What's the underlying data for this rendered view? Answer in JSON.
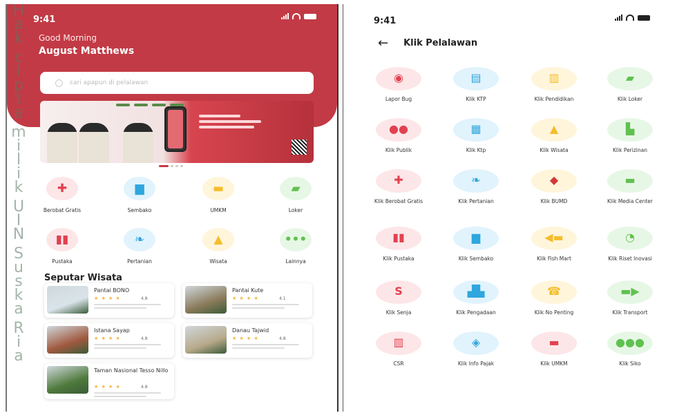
{
  "left_screen": {
    "status_time": "9:41",
    "greeting": "Good Morning",
    "user_name": "August Matthews",
    "search_placeholder": "cari apapun di pelalawan",
    "menu": [
      {
        "label": "Berobat Gratis",
        "icon": "medkit-icon",
        "glyph": "✚",
        "bg": "#fde6e8",
        "fg": "#e2414f"
      },
      {
        "label": "Sembako",
        "icon": "basket-icon",
        "glyph": "▆",
        "bg": "#e1f3fc",
        "fg": "#2ea6de"
      },
      {
        "label": "UMKM",
        "icon": "store-icon",
        "glyph": "▬",
        "bg": "#fff5db",
        "fg": "#f4bd2a"
      },
      {
        "label": "Loker",
        "icon": "briefcase-icon",
        "glyph": "▰",
        "bg": "#e7f7e6",
        "fg": "#5fc24f"
      },
      {
        "label": "Pustaka",
        "icon": "books-icon",
        "glyph": "▮▮",
        "bg": "#fde6e8",
        "fg": "#e2414f"
      },
      {
        "label": "Pertanian",
        "icon": "plant-hand-icon",
        "glyph": "❧",
        "bg": "#e1f3fc",
        "fg": "#2ea6de"
      },
      {
        "label": "Wisata",
        "icon": "tourism-icon",
        "glyph": "▲",
        "bg": "#fff5db",
        "fg": "#f4bd2a"
      },
      {
        "label": "Lainnya",
        "icon": "more-icon",
        "glyph": "•••",
        "bg": "#e7f7e6",
        "fg": "#5fc24f"
      }
    ],
    "section_title": "Seputar Wisata",
    "places": [
      {
        "name": "Pantai BONO",
        "stars": "★ ★ ★ ★",
        "rating": "4.8",
        "thumb": "#d9e4ea"
      },
      {
        "name": "Pantai Kute",
        "stars": "★ ★ ★ ★",
        "rating": "4.1",
        "thumb": "#8a7a5a"
      },
      {
        "name": "Istana Sayap",
        "stars": "★ ★ ★ ★",
        "rating": "4.8",
        "thumb": "#a0593f"
      },
      {
        "name": "Danau Tajwid",
        "stars": "★ ★ ★ ★",
        "rating": "4.8",
        "thumb": "#b7a98a"
      },
      {
        "name": "Taman Nasional Tesso Nillo",
        "stars": "★ ★ ★ ★",
        "rating": "4.8",
        "thumb": "#4f7a3c"
      }
    ],
    "watermark": "Hak cipta milik UIN Suska Ria"
  },
  "right_screen": {
    "status_time": "9:41",
    "page_title": "Klik Pelalawan",
    "services": [
      {
        "label": "Lapor Bug",
        "icon": "bug-report-icon",
        "glyph": "◉",
        "bg": "#fde6e8",
        "fg": "#e2414f"
      },
      {
        "label": "Klik KTP",
        "icon": "id-card-icon",
        "glyph": "▤",
        "bg": "#e1f3fc",
        "fg": "#2ea6de"
      },
      {
        "label": "Klik Pendidikan",
        "icon": "book-open-icon",
        "glyph": "▥",
        "bg": "#fff5db",
        "fg": "#f4bd2a"
      },
      {
        "label": "Klik Loker",
        "icon": "briefcase-icon",
        "glyph": "▰",
        "bg": "#e7f7e6",
        "fg": "#5fc24f"
      },
      {
        "label": "Klik Publik",
        "icon": "people-icon",
        "glyph": "●●",
        "bg": "#fde6e8",
        "fg": "#e2414f"
      },
      {
        "label": "Klik Ktp",
        "icon": "id-card-hand-icon",
        "glyph": "▦",
        "bg": "#e1f3fc",
        "fg": "#2ea6de"
      },
      {
        "label": "Klik Wisata",
        "icon": "tourism-icon",
        "glyph": "▲",
        "bg": "#fff5db",
        "fg": "#f4bd2a"
      },
      {
        "label": "Klik Perizinan",
        "icon": "document-icon",
        "glyph": "▙",
        "bg": "#e7f7e6",
        "fg": "#5fc24f"
      },
      {
        "label": "Klik Berobat Gratis",
        "icon": "medkit-icon",
        "glyph": "✚",
        "bg": "#fde6e8",
        "fg": "#e2414f"
      },
      {
        "label": "Klik Pertanian",
        "icon": "plant-hand-icon",
        "glyph": "❧",
        "bg": "#e1f3fc",
        "fg": "#2ea6de"
      },
      {
        "label": "Klik BUMD",
        "icon": "emblem-icon",
        "glyph": "◆",
        "bg": "#fff5db",
        "fg": "#d23a3a"
      },
      {
        "label": "Klik Media Center",
        "icon": "media-center-icon",
        "glyph": "▬",
        "bg": "#e7f7e6",
        "fg": "#5fc24f"
      },
      {
        "label": "Klik Pustaka",
        "icon": "books-icon",
        "glyph": "▮▮",
        "bg": "#fde6e8",
        "fg": "#e2414f"
      },
      {
        "label": "Klik Sembako",
        "icon": "basket-icon",
        "glyph": "▆",
        "bg": "#e1f3fc",
        "fg": "#2ea6de"
      },
      {
        "label": "Klik Fish Mart",
        "icon": "fish-icon",
        "glyph": "◀▬",
        "bg": "#fff5db",
        "fg": "#f4bd2a"
      },
      {
        "label": "Klik Riset Inovasi",
        "icon": "research-icon",
        "glyph": "◔",
        "bg": "#e7f7e6",
        "fg": "#5fc24f"
      },
      {
        "label": "Klik Senja",
        "icon": "senja-icon",
        "glyph": "S",
        "bg": "#fde6e8",
        "fg": "#e2414f"
      },
      {
        "label": "Klik Pengadaan",
        "icon": "procurement-icon",
        "glyph": "▟▙",
        "bg": "#e1f3fc",
        "fg": "#2ea6de"
      },
      {
        "label": "Klik No Penting",
        "icon": "phone-support-icon",
        "glyph": "☎",
        "bg": "#fff5db",
        "fg": "#f4bd2a"
      },
      {
        "label": "Klik Transport",
        "icon": "truck-icon",
        "glyph": "▬▶",
        "bg": "#e7f7e6",
        "fg": "#5fc24f"
      },
      {
        "label": "CSR",
        "icon": "building-icon",
        "glyph": "▥",
        "bg": "#fde6e8",
        "fg": "#e2414f"
      },
      {
        "label": "Klik Info Pajak",
        "icon": "tax-tag-icon",
        "glyph": "◈",
        "bg": "#e1f3fc",
        "fg": "#2ea6de"
      },
      {
        "label": "Klik UMKM",
        "icon": "store-icon",
        "glyph": "▬",
        "bg": "#fde6e8",
        "fg": "#e2414f"
      },
      {
        "label": "Klik Siko",
        "icon": "group-icon",
        "glyph": "●●●",
        "bg": "#e7f7e6",
        "fg": "#5fc24f"
      }
    ]
  }
}
